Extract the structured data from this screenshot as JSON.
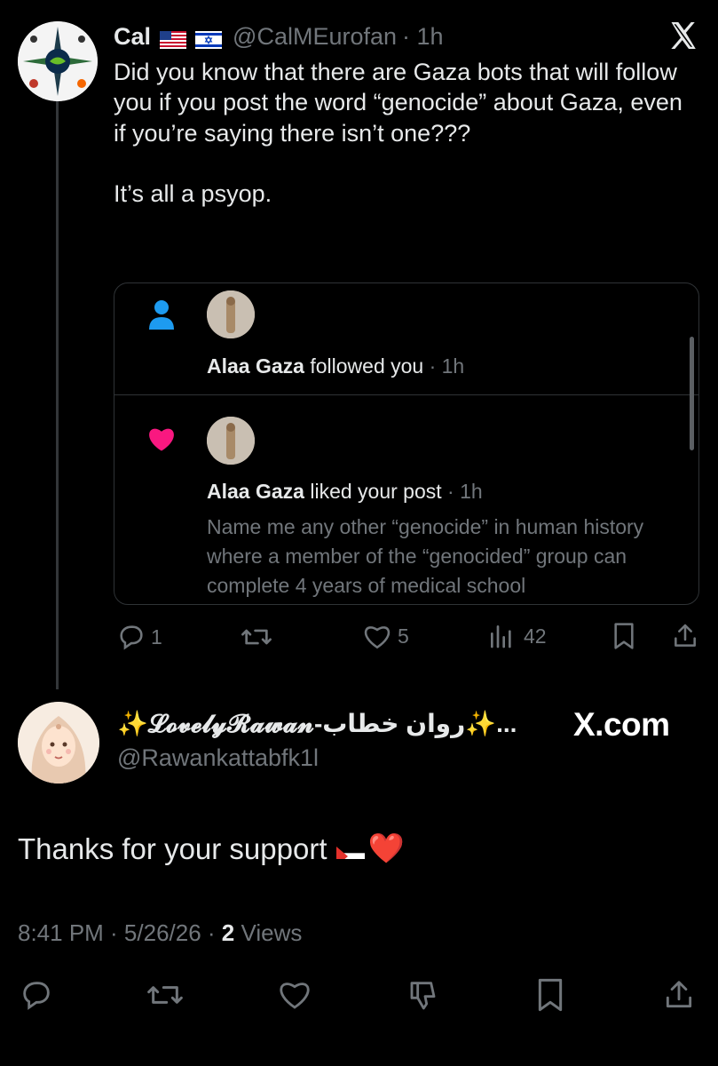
{
  "tweet": {
    "author_name": "Cal",
    "author_flags": [
      "us-flag-icon",
      "israel-flag-icon"
    ],
    "handle": "@CalMEurofan",
    "time": "· 1h",
    "text_line1": "Did you know that there are Gaza bots that will follow you if you post the word “genocide” about Gaza, even if you’re saying there isn’t one???",
    "text_line2": "It’s all a psyop.",
    "actions": {
      "reply_count": "1",
      "repost_count": "",
      "like_count": "5",
      "views_count": "42"
    }
  },
  "quoted_screenshot": {
    "notif1": {
      "icon": "person-icon",
      "name": "Alaa Gaza",
      "action": " followed you",
      "time": " · 1h"
    },
    "notif2": {
      "icon": "heart-icon",
      "name": "Alaa Gaza",
      "action": " liked your post",
      "time": " · 1h",
      "body": "Name me any other “genocide” in human history where a member of the “genocided” group can complete 4 years of medical school"
    }
  },
  "reply": {
    "display_name": "✨𝓛𝓸𝓿𝓮𝓵𝔂𝓡𝓪𝔀𝓪𝓷-روان خطاب✨...",
    "handle": "@Rawankattabfk1l",
    "site_badge": "X.com",
    "text": "Thanks for your support",
    "emoji_after": "❤️",
    "timestamp": "8:41 PM · 5/26/26 · ",
    "views_count": "2",
    "views_label": " Views"
  },
  "colors": {
    "background": "#000000",
    "text_primary": "#e7e9ea",
    "text_secondary": "#71767b",
    "follow_icon": "#1d9bf0",
    "like_icon": "#f91880"
  }
}
